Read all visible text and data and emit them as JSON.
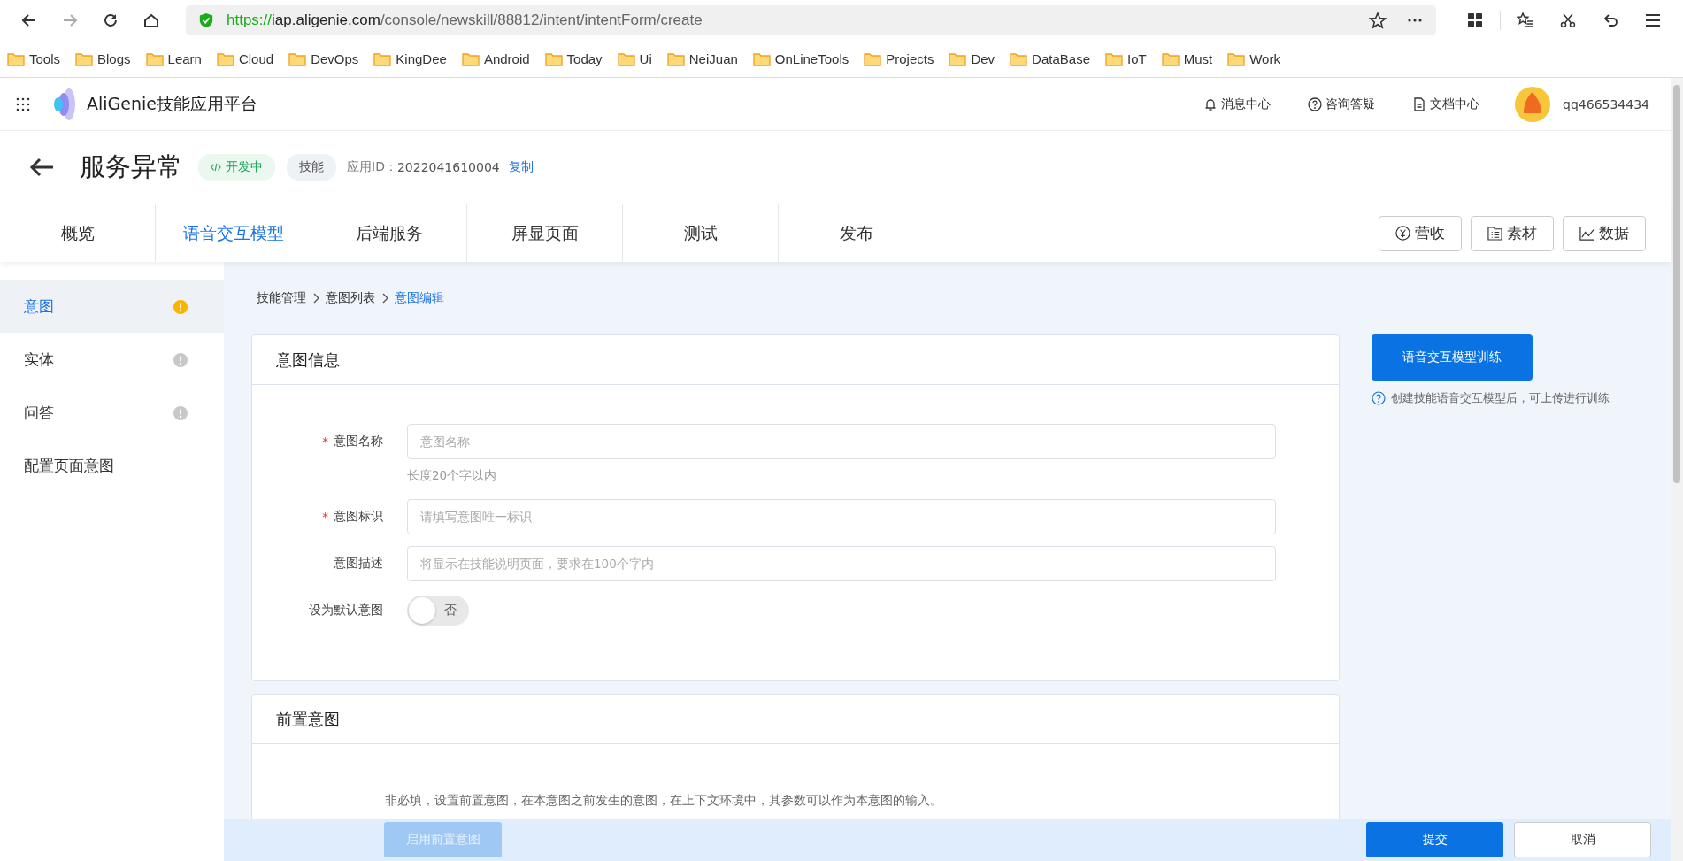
{
  "browser": {
    "url": {
      "scheme": "https://",
      "host": "iap.aligenie.com",
      "path": "/console/newskill/88812/intent/intentForm/create"
    },
    "bookmarks": [
      "Tools",
      "Blogs",
      "Learn",
      "Cloud",
      "DevOps",
      "KingDee",
      "Android",
      "Today",
      "Ui",
      "NeiJuan",
      "OnLineTools",
      "Projects",
      "Dev",
      "DataBase",
      "IoT",
      "Must",
      "Work"
    ]
  },
  "header": {
    "brand": "AliGenie技能应用平台",
    "links": [
      {
        "kind": "bell",
        "label": "消息中心"
      },
      {
        "kind": "help",
        "label": "咨询答疑"
      },
      {
        "kind": "doc",
        "label": "文档中心"
      }
    ],
    "username": "qq466534434"
  },
  "skill": {
    "title": "服务异常",
    "status": "开发中",
    "type": "技能",
    "app_id_label": "应用ID：",
    "app_id": "2022041610004",
    "copy": "复制"
  },
  "tabs": [
    {
      "label": "概览",
      "selected": false
    },
    {
      "label": "语音交互模型",
      "selected": true
    },
    {
      "label": "后端服务",
      "selected": false
    },
    {
      "label": "屏显页面",
      "selected": false
    },
    {
      "label": "测试",
      "selected": false
    },
    {
      "label": "发布",
      "selected": false
    }
  ],
  "tool_buttons": [
    {
      "kind": "yen",
      "label": "营收"
    },
    {
      "kind": "folder",
      "label": "素材"
    },
    {
      "kind": "chart",
      "label": "数据"
    }
  ],
  "sidebar": {
    "items": [
      {
        "label": "意图",
        "selected": true,
        "warning": true
      },
      {
        "label": "实体",
        "selected": false,
        "warning": false
      },
      {
        "label": "问答",
        "selected": false,
        "warning": false
      },
      {
        "label": "配置页面意图",
        "selected": false
      }
    ]
  },
  "breadcrumb": [
    {
      "label": "技能管理",
      "current": false
    },
    {
      "label": "意图列表",
      "current": false
    },
    {
      "label": "意图编辑",
      "current": true
    }
  ],
  "intent_info": {
    "title": "意图信息",
    "fields": [
      {
        "label": "意图名称",
        "required_mark": "*",
        "placeholder": "意图名称",
        "hint": "长度20个字以内"
      },
      {
        "label": "意图标识",
        "required_mark": "*",
        "placeholder": "请填写意图唯一标识"
      },
      {
        "label": "意图描述",
        "placeholder": "将显示在技能说明页面，要求在100个字内"
      }
    ],
    "default_toggle": {
      "label": "设为默认意图",
      "on": false,
      "text": "否"
    }
  },
  "pre_intent": {
    "title": "前置意图",
    "note": "非必填，设置前置意图，在本意图之前发生的意图，在上下文环境中，其参数可以作为本意图的输入。"
  },
  "training": {
    "button": "语音交互模型训练",
    "hint": "创建技能语音交互模型后，可上传进行训练"
  },
  "footer": {
    "enable": {
      "label": "启用前置意图",
      "disabled": true
    },
    "submit": "提交",
    "cancel": "取消"
  }
}
